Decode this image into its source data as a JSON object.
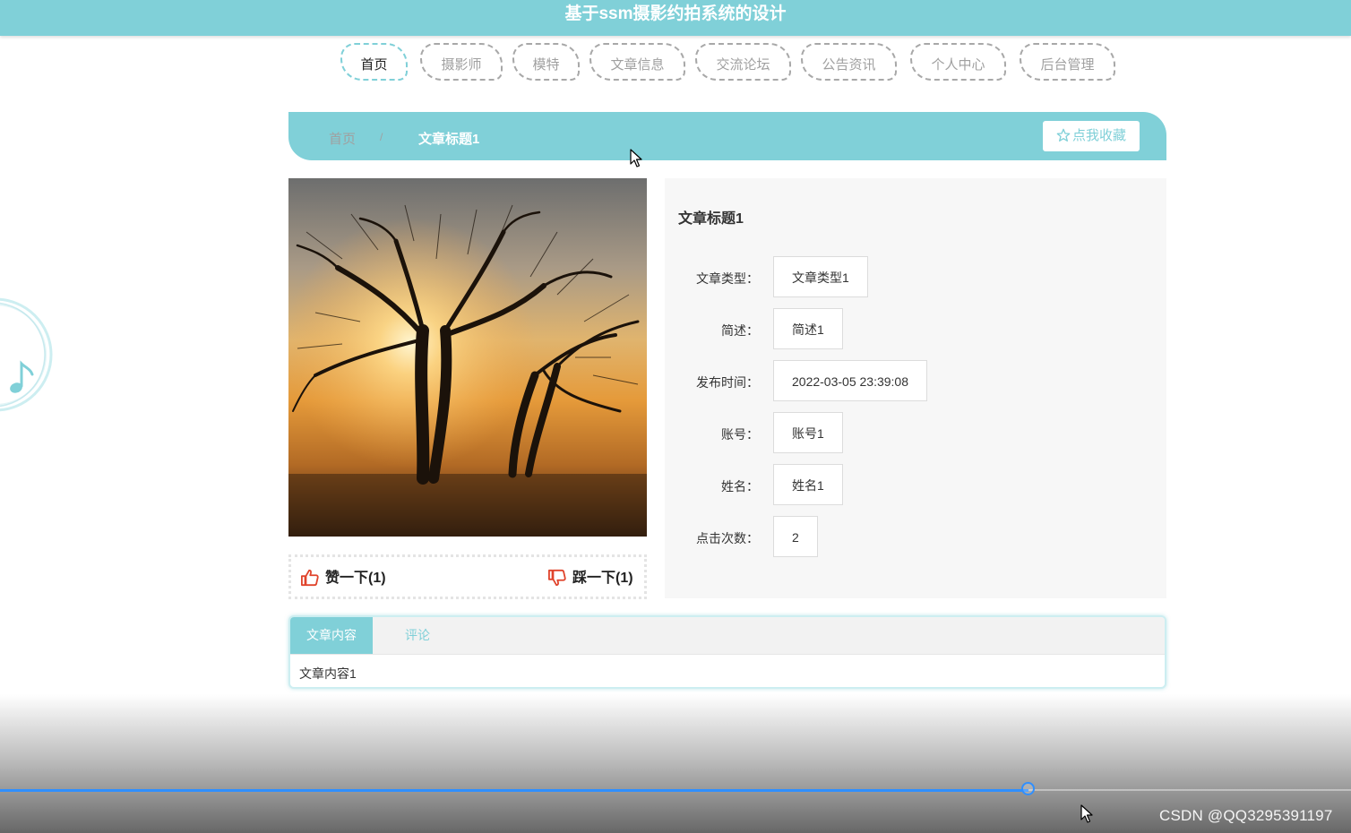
{
  "header": {
    "title": "基于ssm摄影约拍系统的设计"
  },
  "nav": {
    "items": [
      {
        "label": "首页",
        "active": true
      },
      {
        "label": "摄影师"
      },
      {
        "label": "模特"
      },
      {
        "label": "文章信息"
      },
      {
        "label": "交流论坛"
      },
      {
        "label": "公告资讯"
      },
      {
        "label": "个人中心"
      },
      {
        "label": "后台管理"
      }
    ]
  },
  "breadcrumb": {
    "home": "首页",
    "separator": "/",
    "current": "文章标题1"
  },
  "favorite_button": {
    "label": "点我收藏",
    "icon": "star-outline-icon"
  },
  "votes": {
    "like": {
      "label": "赞一下(1)",
      "icon": "thumbs-up-icon"
    },
    "dislike": {
      "label": "踩一下(1)",
      "icon": "thumbs-down-icon"
    }
  },
  "article": {
    "title": "文章标题1",
    "fields": [
      {
        "label": "文章类型：",
        "value": "文章类型1"
      },
      {
        "label": "简述：",
        "value": "简述1"
      },
      {
        "label": "发布时间：",
        "value": "2022-03-05 23:39:08"
      },
      {
        "label": "账号：",
        "value": "账号1"
      },
      {
        "label": "姓名：",
        "value": "姓名1"
      },
      {
        "label": "点击次数：",
        "value": "2"
      }
    ]
  },
  "tabs": {
    "items": [
      {
        "label": "文章内容",
        "active": true
      },
      {
        "label": "评论"
      }
    ],
    "content": "文章内容1"
  },
  "video_player": {
    "progress": 0.761
  },
  "watermark": "CSDN @QQ3295391197",
  "colors": {
    "accent": "#80d0d8",
    "progress": "#2f8fff",
    "vote_icon": "#e0442c"
  }
}
